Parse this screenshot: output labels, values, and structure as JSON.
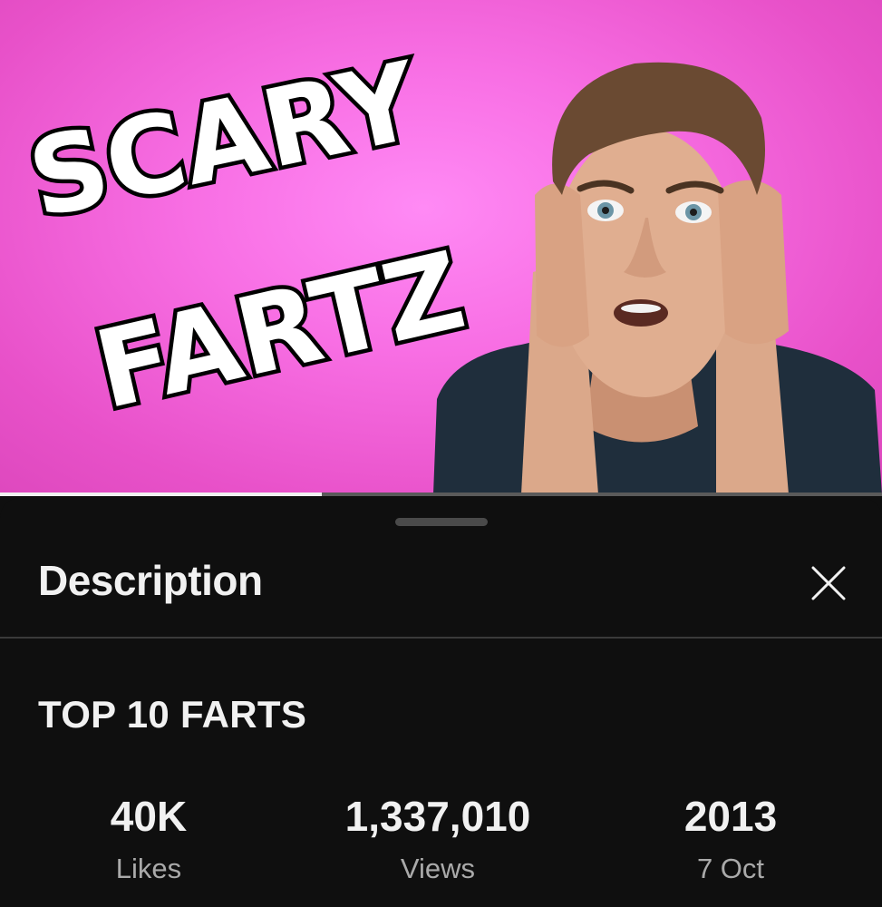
{
  "thumbnail": {
    "line1": "SCARY",
    "line2": "FARTZ",
    "progress": 0.365
  },
  "sheet": {
    "title": "Description",
    "close_icon": "close-icon"
  },
  "video": {
    "title": "TOP 10 FARTS"
  },
  "stats": [
    {
      "value": "40K",
      "label": "Likes"
    },
    {
      "value": "1,337,010",
      "label": "Views"
    },
    {
      "value": "2013",
      "label": "7 Oct"
    }
  ],
  "colors": {
    "thumbnail_pink": "#f86fe4",
    "sheet_background": "#0f0f0f",
    "secondary_text": "#aaaaaa"
  }
}
